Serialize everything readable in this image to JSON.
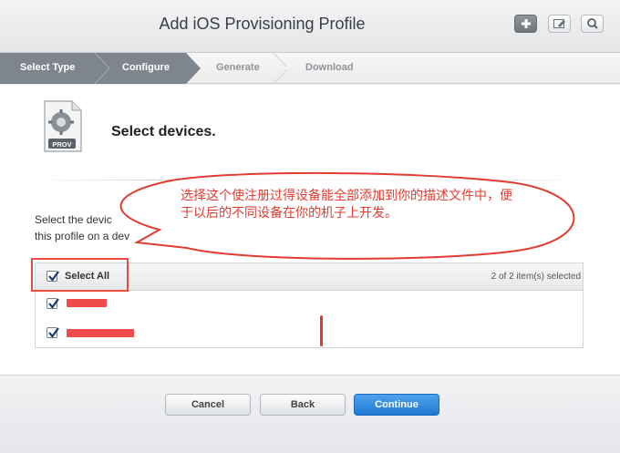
{
  "window": {
    "title": "Add iOS Provisioning Profile"
  },
  "toolbar": {
    "add_icon": "plus-icon",
    "edit_icon": "edit-icon",
    "search_icon": "search-icon"
  },
  "steps": [
    {
      "label": "Select Type",
      "state": "active"
    },
    {
      "label": "Configure",
      "state": "active"
    },
    {
      "label": "Generate",
      "state": "inactive"
    },
    {
      "label": "Download",
      "state": "inactive"
    }
  ],
  "main": {
    "icon_label": "PROV",
    "heading": "Select devices.",
    "description_line1": "Select the devic",
    "description_line2": "this profile on a dev"
  },
  "devices": {
    "select_all_label": "Select All",
    "selection_count": "2 of 2 item(s) selected",
    "rows": [
      {
        "checked": true,
        "name_redacted": true
      },
      {
        "checked": true,
        "name_redacted": true
      }
    ]
  },
  "annotation": {
    "callout_text": "选择这个使注册过得设备能全部添加到你的描述文件中，便于以后的不同设备在你的机子上开发。",
    "color": "#e23b30"
  },
  "footer": {
    "cancel_label": "Cancel",
    "back_label": "Back",
    "continue_label": "Continue"
  },
  "colors": {
    "step_active": "#7e858c",
    "primary_button": "#1f77d2",
    "redaction": "#ef4b4b"
  }
}
